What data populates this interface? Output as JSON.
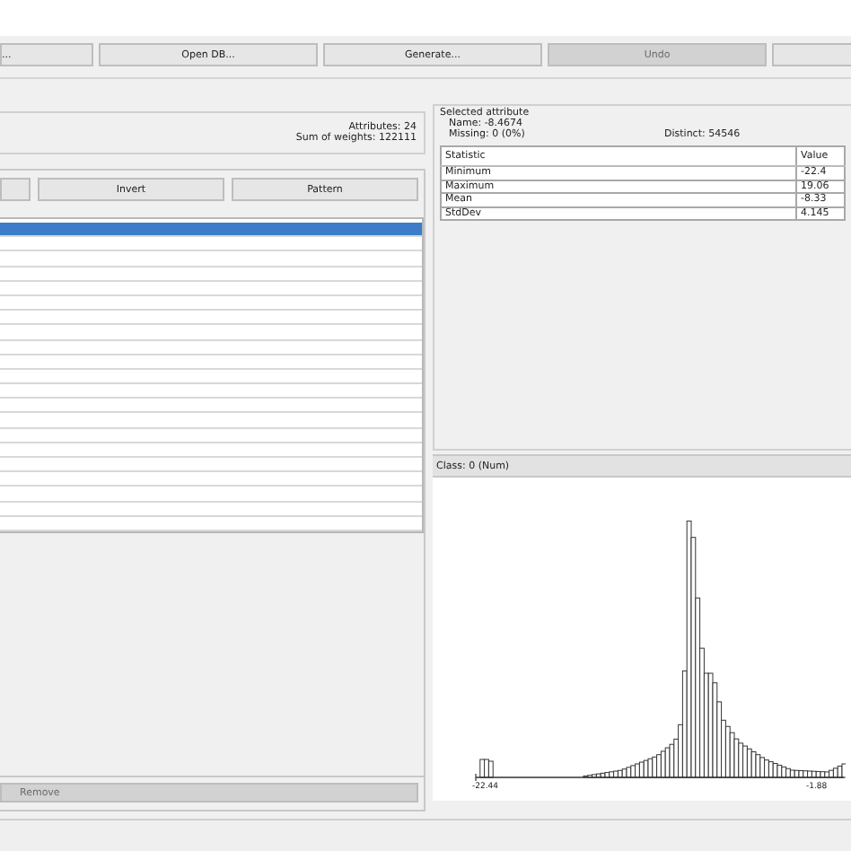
{
  "toolbar": {
    "buttons": [
      {
        "label": "...",
        "disabled": false
      },
      {
        "label": "Open DB...",
        "disabled": false
      },
      {
        "label": "Generate...",
        "disabled": false
      },
      {
        "label": "Undo",
        "disabled": true
      },
      {
        "disabled": false
      }
    ]
  },
  "current_relation": {
    "attributes": "Attributes: 24",
    "sum_of_weights": "Sum of weights: 122111"
  },
  "attributes": {
    "buttons": [
      {
        "disabled": false
      },
      {
        "label": "Invert",
        "disabled": false
      },
      {
        "label": "Pattern",
        "disabled": false
      }
    ],
    "rows": [
      {
        "selected": true
      },
      {
        "selected": false
      },
      {
        "selected": false
      },
      {
        "selected": false
      },
      {
        "selected": false
      },
      {
        "selected": false
      },
      {
        "selected": false
      },
      {
        "selected": false
      },
      {
        "selected": false
      },
      {
        "selected": false
      },
      {
        "selected": false
      },
      {
        "selected": false
      },
      {
        "selected": false
      },
      {
        "selected": false
      },
      {
        "selected": false
      },
      {
        "selected": false
      },
      {
        "selected": false
      },
      {
        "selected": false
      },
      {
        "selected": false
      },
      {
        "selected": false
      },
      {
        "selected": false
      }
    ],
    "remove_button": {
      "label": "Remove",
      "disabled": true
    }
  },
  "selected_attribute": {
    "title": "Selected attribute",
    "name": "Name: -8.4674",
    "missing": "Missing: 0 (0%)",
    "distinct": "Distinct: 54546",
    "columns": [
      "Statistic",
      "Value"
    ],
    "rows": [
      [
        "Minimum",
        "-22.4"
      ],
      [
        "Maximum",
        "19.06"
      ],
      [
        "Mean",
        "-8.33"
      ],
      [
        "StdDev",
        "4.145"
      ]
    ]
  },
  "class_selector": "Class: 0 (Num)",
  "histogram": {
    "x_min": "-22.44",
    "x_max": "-1.88"
  }
}
